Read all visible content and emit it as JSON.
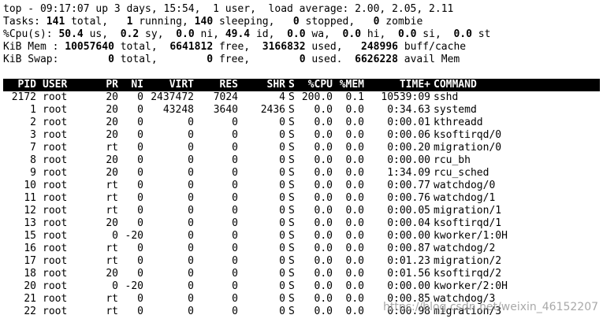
{
  "summary": {
    "line1": "top - 09:17:07 up 3 days, 15:54,  1 user,  load average: 2.00, 2.05, 2.11",
    "tasks": {
      "label": "Tasks: ",
      "total": "141",
      "total_label": " total,   ",
      "running": "1",
      "running_label": " running, ",
      "sleeping": "140",
      "sleeping_label": " sleeping,   ",
      "stopped": "0",
      "stopped_label": " stopped,   ",
      "zombie": "0",
      "zombie_label": " zombie"
    },
    "cpu": {
      "label": "%Cpu(s): ",
      "us": "50.4",
      "us_label": " us,  ",
      "sy": "0.2",
      "sy_label": " sy,  ",
      "ni": "0.0",
      "ni_label": " ni, ",
      "id": "49.4",
      "id_label": " id,  ",
      "wa": "0.0",
      "wa_label": " wa,  ",
      "hi": "0.0",
      "hi_label": " hi,  ",
      "si": "0.0",
      "si_label": " si,  ",
      "st": "0.0",
      "st_label": " st"
    },
    "mem": {
      "label": "KiB Mem : ",
      "total": "10057640",
      "total_label": " total,  ",
      "free": "6641812",
      "free_label": " free,  ",
      "used": "3166832",
      "used_label": " used,   ",
      "buff": "248996",
      "buff_label": " buff/cache"
    },
    "swap": {
      "label": "KiB Swap:        ",
      "total": "0",
      "total_label": " total,        ",
      "free": "0",
      "free_label": " free,        ",
      "used": "0",
      "used_label": " used.  ",
      "avail": "6626228",
      "avail_label": " avail Mem"
    }
  },
  "columns": {
    "pid": "PID",
    "user": "USER",
    "pr": "PR",
    "ni": "NI",
    "virt": "VIRT",
    "res": "RES",
    "shr": "SHR",
    "s": "S",
    "cpu": "%CPU",
    "mem": "%MEM",
    "time": "TIME+",
    "command": "COMMAND"
  },
  "processes": [
    {
      "pid": "2172",
      "user": "root",
      "pr": "20",
      "ni": "0",
      "virt": "2437472",
      "res": "7024",
      "shr": "4",
      "s": "S",
      "cpu": "200.0",
      "mem": "0.1",
      "time": "10539:09",
      "command": "sshd"
    },
    {
      "pid": "1",
      "user": "root",
      "pr": "20",
      "ni": "0",
      "virt": "43248",
      "res": "3640",
      "shr": "2436",
      "s": "S",
      "cpu": "0.0",
      "mem": "0.0",
      "time": "0:34.63",
      "command": "systemd"
    },
    {
      "pid": "2",
      "user": "root",
      "pr": "20",
      "ni": "0",
      "virt": "0",
      "res": "0",
      "shr": "0",
      "s": "S",
      "cpu": "0.0",
      "mem": "0.0",
      "time": "0:00.01",
      "command": "kthreadd"
    },
    {
      "pid": "3",
      "user": "root",
      "pr": "20",
      "ni": "0",
      "virt": "0",
      "res": "0",
      "shr": "0",
      "s": "S",
      "cpu": "0.0",
      "mem": "0.0",
      "time": "0:00.06",
      "command": "ksoftirqd/0"
    },
    {
      "pid": "7",
      "user": "root",
      "pr": "rt",
      "ni": "0",
      "virt": "0",
      "res": "0",
      "shr": "0",
      "s": "S",
      "cpu": "0.0",
      "mem": "0.0",
      "time": "0:00.20",
      "command": "migration/0"
    },
    {
      "pid": "8",
      "user": "root",
      "pr": "20",
      "ni": "0",
      "virt": "0",
      "res": "0",
      "shr": "0",
      "s": "S",
      "cpu": "0.0",
      "mem": "0.0",
      "time": "0:00.00",
      "command": "rcu_bh"
    },
    {
      "pid": "9",
      "user": "root",
      "pr": "20",
      "ni": "0",
      "virt": "0",
      "res": "0",
      "shr": "0",
      "s": "S",
      "cpu": "0.0",
      "mem": "0.0",
      "time": "1:34.09",
      "command": "rcu_sched"
    },
    {
      "pid": "10",
      "user": "root",
      "pr": "rt",
      "ni": "0",
      "virt": "0",
      "res": "0",
      "shr": "0",
      "s": "S",
      "cpu": "0.0",
      "mem": "0.0",
      "time": "0:00.77",
      "command": "watchdog/0"
    },
    {
      "pid": "11",
      "user": "root",
      "pr": "rt",
      "ni": "0",
      "virt": "0",
      "res": "0",
      "shr": "0",
      "s": "S",
      "cpu": "0.0",
      "mem": "0.0",
      "time": "0:00.76",
      "command": "watchdog/1"
    },
    {
      "pid": "12",
      "user": "root",
      "pr": "rt",
      "ni": "0",
      "virt": "0",
      "res": "0",
      "shr": "0",
      "s": "S",
      "cpu": "0.0",
      "mem": "0.0",
      "time": "0:00.05",
      "command": "migration/1"
    },
    {
      "pid": "13",
      "user": "root",
      "pr": "20",
      "ni": "0",
      "virt": "0",
      "res": "0",
      "shr": "0",
      "s": "S",
      "cpu": "0.0",
      "mem": "0.0",
      "time": "0:00.04",
      "command": "ksoftirqd/1"
    },
    {
      "pid": "15",
      "user": "root",
      "pr": "0",
      "ni": "-20",
      "virt": "0",
      "res": "0",
      "shr": "0",
      "s": "S",
      "cpu": "0.0",
      "mem": "0.0",
      "time": "0:00.00",
      "command": "kworker/1:0H"
    },
    {
      "pid": "16",
      "user": "root",
      "pr": "rt",
      "ni": "0",
      "virt": "0",
      "res": "0",
      "shr": "0",
      "s": "S",
      "cpu": "0.0",
      "mem": "0.0",
      "time": "0:00.87",
      "command": "watchdog/2"
    },
    {
      "pid": "17",
      "user": "root",
      "pr": "rt",
      "ni": "0",
      "virt": "0",
      "res": "0",
      "shr": "0",
      "s": "S",
      "cpu": "0.0",
      "mem": "0.0",
      "time": "0:01.23",
      "command": "migration/2"
    },
    {
      "pid": "18",
      "user": "root",
      "pr": "20",
      "ni": "0",
      "virt": "0",
      "res": "0",
      "shr": "0",
      "s": "S",
      "cpu": "0.0",
      "mem": "0.0",
      "time": "0:01.56",
      "command": "ksoftirqd/2"
    },
    {
      "pid": "20",
      "user": "root",
      "pr": "0",
      "ni": "-20",
      "virt": "0",
      "res": "0",
      "shr": "0",
      "s": "S",
      "cpu": "0.0",
      "mem": "0.0",
      "time": "0:00.00",
      "command": "kworker/2:0H"
    },
    {
      "pid": "21",
      "user": "root",
      "pr": "rt",
      "ni": "0",
      "virt": "0",
      "res": "0",
      "shr": "0",
      "s": "S",
      "cpu": "0.0",
      "mem": "0.0",
      "time": "0:00.85",
      "command": "watchdog/3"
    },
    {
      "pid": "22",
      "user": "root",
      "pr": "rt",
      "ni": "0",
      "virt": "0",
      "res": "0",
      "shr": "0",
      "s": "S",
      "cpu": "0.0",
      "mem": "0.0",
      "time": "0:00.98",
      "command": "migration/3"
    }
  ],
  "watermark": "https://blog.csdn.net/weixin_46152207"
}
